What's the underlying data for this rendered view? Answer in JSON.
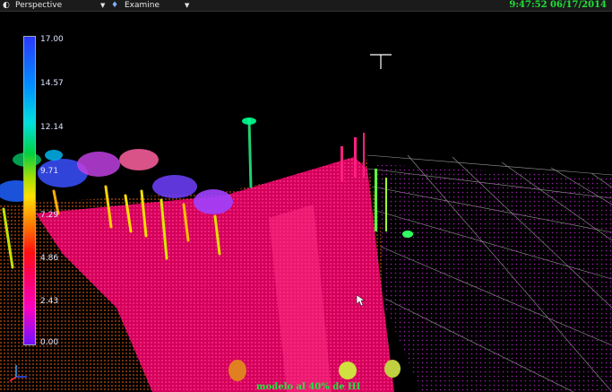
{
  "toolbar": {
    "view_mode": "Perspective",
    "navigation_mode": "Examine",
    "timestamp": "9:47:52  06/17/2014"
  },
  "colorbar": {
    "ticks": [
      "17.00",
      "14.57",
      "12.14",
      "9.71",
      "7.29",
      "4.86",
      "2.43",
      "0.00"
    ]
  },
  "caption": "modelo  al  40% de HI",
  "colors": {
    "timestamp": "#21e23a",
    "caption": "#20e640",
    "background": "#000000"
  }
}
